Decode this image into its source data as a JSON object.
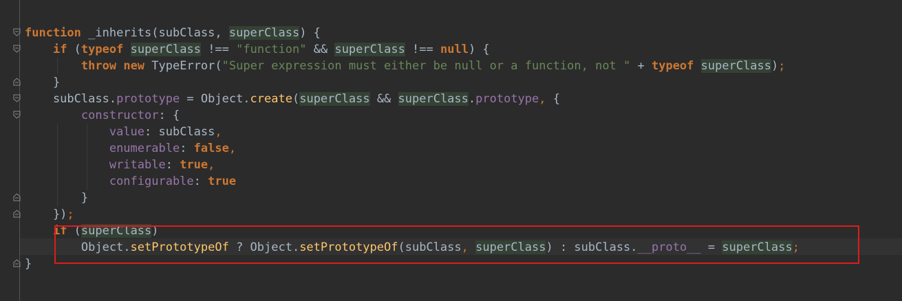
{
  "editor": {
    "colors": {
      "background": "#2b2b2b",
      "keyword": "#cc7832",
      "string": "#6a8759",
      "property": "#9876aa",
      "method": "#ffc66d",
      "text": "#a9b7c6",
      "usage_highlight": "#344134",
      "annotation_box": "#e01b1b"
    },
    "lines": [
      [
        {
          "t": "function",
          "c": "kw"
        },
        {
          "t": " _inherits(subClass, "
        },
        {
          "t": "superClass",
          "c": "hl"
        },
        {
          "t": ") {"
        }
      ],
      [
        {
          "t": "    "
        },
        {
          "t": "if",
          "c": "kw"
        },
        {
          "t": " ("
        },
        {
          "t": "typeof",
          "c": "kw"
        },
        {
          "t": " "
        },
        {
          "t": "superClass",
          "c": "hl"
        },
        {
          "t": " !== "
        },
        {
          "t": "\"function\"",
          "c": "str"
        },
        {
          "t": " && "
        },
        {
          "t": "superClass",
          "c": "hl"
        },
        {
          "t": " !== "
        },
        {
          "t": "null",
          "c": "kw"
        },
        {
          "t": ") {"
        }
      ],
      [
        {
          "t": "        "
        },
        {
          "t": "throw",
          "c": "kw"
        },
        {
          "t": " "
        },
        {
          "t": "new",
          "c": "kw"
        },
        {
          "t": " TypeError("
        },
        {
          "t": "\"Super expression must either be null or a function, not \"",
          "c": "str"
        },
        {
          "t": " + "
        },
        {
          "t": "typeof",
          "c": "kw"
        },
        {
          "t": " "
        },
        {
          "t": "superClass",
          "c": "hl"
        },
        {
          "t": ")"
        },
        {
          "t": ";",
          "c": "punc"
        }
      ],
      [
        {
          "t": "    }"
        }
      ],
      [
        {
          "t": "    subClass."
        },
        {
          "t": "prototype",
          "c": "prop"
        },
        {
          "t": " = Object."
        },
        {
          "t": "create",
          "c": "fn"
        },
        {
          "t": "("
        },
        {
          "t": "superClass",
          "c": "hl"
        },
        {
          "t": " && "
        },
        {
          "t": "superClass",
          "c": "hl"
        },
        {
          "t": "."
        },
        {
          "t": "prototype",
          "c": "prop"
        },
        {
          "t": ",",
          "c": "punc"
        },
        {
          "t": " {"
        }
      ],
      [
        {
          "t": "        "
        },
        {
          "t": "constructor",
          "c": "prop"
        },
        {
          "t": ": {"
        }
      ],
      [
        {
          "t": "            "
        },
        {
          "t": "value",
          "c": "prop"
        },
        {
          "t": ": subClass"
        },
        {
          "t": ",",
          "c": "punc"
        }
      ],
      [
        {
          "t": "            "
        },
        {
          "t": "enumerable",
          "c": "prop"
        },
        {
          "t": ": "
        },
        {
          "t": "false",
          "c": "kw"
        },
        {
          "t": ",",
          "c": "punc"
        }
      ],
      [
        {
          "t": "            "
        },
        {
          "t": "writable",
          "c": "prop"
        },
        {
          "t": ": "
        },
        {
          "t": "true",
          "c": "kw"
        },
        {
          "t": ",",
          "c": "punc"
        }
      ],
      [
        {
          "t": "            "
        },
        {
          "t": "configurable",
          "c": "prop"
        },
        {
          "t": ": "
        },
        {
          "t": "true",
          "c": "kw"
        }
      ],
      [
        {
          "t": "        }"
        }
      ],
      [
        {
          "t": "    })"
        },
        {
          "t": ";",
          "c": "punc"
        }
      ],
      [
        {
          "t": "    "
        },
        {
          "t": "if",
          "c": "kw"
        },
        {
          "t": " ("
        },
        {
          "t": "superClass",
          "c": "hl"
        },
        {
          "t": ")"
        }
      ],
      [
        {
          "t": "        Object."
        },
        {
          "t": "setPrototypeOf",
          "c": "fn"
        },
        {
          "t": " ? Object."
        },
        {
          "t": "setPrototypeOf",
          "c": "fn"
        },
        {
          "t": "(subClass"
        },
        {
          "t": ",",
          "c": "punc"
        },
        {
          "t": " "
        },
        {
          "t": "superClass",
          "c": "hl"
        },
        {
          "t": ") : subClass."
        },
        {
          "t": "__proto__",
          "c": "prop"
        },
        {
          "t": " = "
        },
        {
          "t": "superClass",
          "c": "hl"
        },
        {
          "t": ";",
          "c": "punc"
        }
      ],
      [
        {
          "t": "}"
        }
      ]
    ]
  }
}
